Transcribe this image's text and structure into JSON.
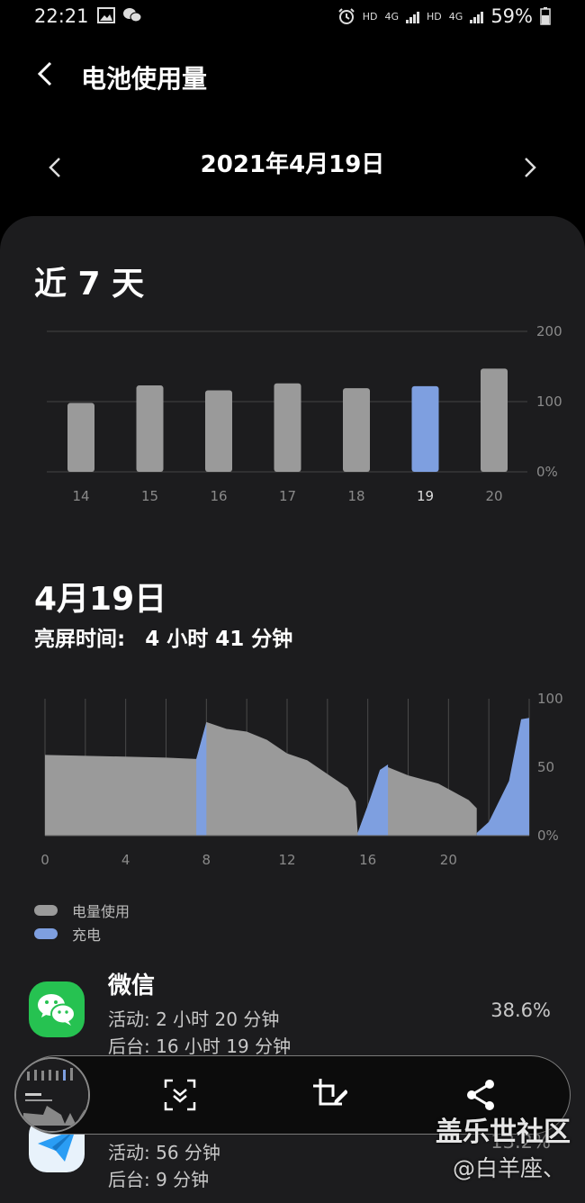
{
  "status": {
    "time": "22:21",
    "hd1": "HD",
    "net1": "4G",
    "hd2": "HD",
    "net2": "4G",
    "battery": "59%"
  },
  "header": {
    "title": "电池使用量"
  },
  "date_nav": {
    "label": "2021年4月19日"
  },
  "weekly": {
    "title": "近 7 天"
  },
  "daily": {
    "title": "4月19日",
    "screen_time_label": "亮屏时间:",
    "screen_time_value": "4 小时 41 分钟"
  },
  "legend": {
    "usage_label": "电量使用",
    "charge_label": "充电",
    "usage_color": "#9a9a9a",
    "charge_color": "#7e9fe0"
  },
  "chart_data": [
    {
      "type": "bar",
      "categories": [
        "14",
        "15",
        "16",
        "17",
        "18",
        "19",
        "20"
      ],
      "values": [
        98,
        123,
        116,
        126,
        119,
        122,
        147
      ],
      "highlighted_category": "19",
      "ytick_labels": [
        "200",
        "100",
        "0%"
      ],
      "ylim": [
        0,
        200
      ],
      "grid": true,
      "bar_color": "#9a9a9a",
      "highlight_color": "#7e9fe0"
    },
    {
      "type": "area",
      "x_tick_labels": [
        "0",
        "4",
        "8",
        "12",
        "16",
        "20"
      ],
      "y_tick_labels": [
        "100",
        "50",
        "0%"
      ],
      "xlim": [
        0,
        24
      ],
      "ylim": [
        0,
        100
      ],
      "grid": true,
      "usage_points": [
        [
          0,
          59
        ],
        [
          3,
          58
        ],
        [
          6,
          57
        ],
        [
          7.5,
          56
        ],
        [
          8,
          83
        ],
        [
          9,
          78
        ],
        [
          10,
          76
        ],
        [
          11,
          70
        ],
        [
          12,
          60
        ],
        [
          13,
          55
        ],
        [
          14,
          45
        ],
        [
          15,
          35
        ],
        [
          15.4,
          25
        ],
        [
          15.5,
          2
        ],
        [
          16.6,
          46
        ],
        [
          17,
          50
        ],
        [
          18,
          44
        ],
        [
          19.5,
          38
        ],
        [
          21,
          26
        ],
        [
          21.4,
          20
        ],
        [
          21.4,
          2
        ]
      ],
      "charge_segments": [
        [
          [
            7.5,
            0
          ],
          [
            7.5,
            56
          ],
          [
            8,
            83
          ],
          [
            8,
            0
          ]
        ],
        [
          [
            15.5,
            2
          ],
          [
            16,
            22
          ],
          [
            16.6,
            48
          ],
          [
            17,
            52
          ],
          [
            17,
            0
          ],
          [
            15.5,
            0
          ]
        ],
        [
          [
            21.4,
            2
          ],
          [
            22,
            10
          ],
          [
            23,
            40
          ],
          [
            23.6,
            85
          ],
          [
            24,
            86
          ],
          [
            24,
            0
          ],
          [
            21.4,
            0
          ]
        ]
      ]
    }
  ],
  "apps": [
    {
      "name": "微信",
      "active": "活动: 2 小时 20 分钟",
      "background": "后台: 16 小时 19 分钟",
      "percent": "38.6%",
      "icon": "wechat-icon",
      "color": "#26c251"
    },
    {
      "name": "",
      "active": "活动: 56 分钟",
      "background": "后台: 9 分钟",
      "percent": "13.2%",
      "icon": "paper-plane-icon",
      "color": "#2a9df4"
    }
  ],
  "toolbar": {
    "icons": [
      "scroll-capture-icon",
      "crop-edit-icon",
      "share-icon"
    ]
  },
  "watermark": {
    "line1": "盖乐世社区",
    "line2": "@白羊座、"
  }
}
